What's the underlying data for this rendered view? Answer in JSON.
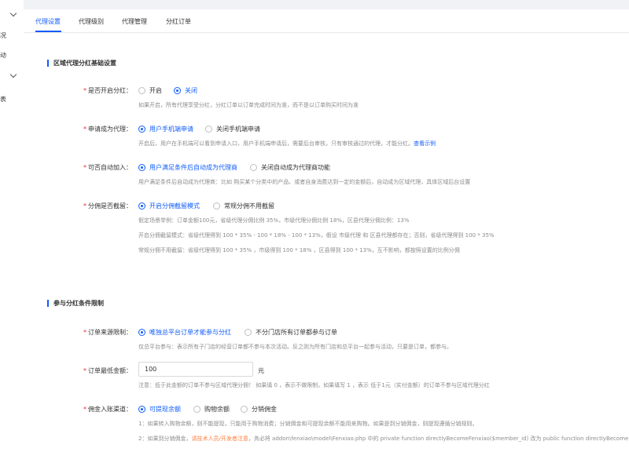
{
  "sidebar": {
    "items": [
      {
        "label": "况"
      },
      {
        "label": "动"
      },
      {
        "label": "表"
      }
    ]
  },
  "tabs": [
    {
      "label": "代理设置",
      "active": true
    },
    {
      "label": "代理级别"
    },
    {
      "label": "代理管理"
    },
    {
      "label": "分红订单"
    }
  ],
  "section1": {
    "title": "区域代理分红基础设置",
    "enable": {
      "label": "是否开启分红：",
      "options": [
        "开启",
        "关闭"
      ],
      "selected": "关闭",
      "hint": "如果开启，所有代理享受分红，分红订单以订单完成时间为准，而不是以订单购买时间为准"
    },
    "apply": {
      "label": "申请成为代理：",
      "options": [
        "用户手机端申请",
        "关闭手机端申请"
      ],
      "selected": "用户手机端申请",
      "hint": "开启后，用户在手机端可以看到申请入口，用户手机端申请后，需要后台审核，只有审核通过的代理，才能分红。",
      "hint_link": "查看示例"
    },
    "auto_join": {
      "label": "可否自动加入：",
      "options": [
        "用户满足条件后自动成为代理商",
        "关闭自动成为代理商功能"
      ],
      "selected": "用户满足条件后自动成为代理商",
      "hint": "用户满足条件后自动成为代理商：比如 购买某个分类中的产品、或者自身消费达到一定的金额后，自动成为区域代理，具体区域后台设置"
    },
    "retain": {
      "label": "分佣是否截留：",
      "options": [
        "开启分佣截留模式",
        "常规分佣不用截留"
      ],
      "selected": "开启分佣截留模式",
      "hints": [
        "假定场景举例：订单金额100元，省级代理分佣比例 35%，市级代理分佣比例 18%，区县代理分佣比例：13%",
        "开启分佣截留模式：省级代理得到 100 * 35% - 100 * 18% - 100 * 13%，假设 市级代理 和 区县代理都存在；否则，省级代理得到 100 * 35%",
        "常规分佣不用截留：省级代理得到 100 * 35% ，市级得到 100 * 18% ，区县得到 100 * 13%，互不影响，都按照设置的比例分佣"
      ]
    }
  },
  "section2": {
    "title": "参与分红条件限制",
    "source": {
      "label": "订单来源限制：",
      "options": [
        "唯独总平台订单才能参与分红",
        "不分门店所有订单都参与订单"
      ],
      "selected": "唯独总平台订单才能参与分红",
      "hint": "仅总平台参与：表示所有子门店的经营订单都不参与本次活动。反之则为所有门店和总平台一起参与活动，只要是订单，都参与。"
    },
    "min_amount": {
      "label": "订单最低金额：",
      "value": "100",
      "unit": "元",
      "hint": "注意：低于此金额的订单不参与区域代理分佣！ 如果填 0 ，表示不做限制，如果填写 1 ，表示 低于1元（实付金额）的订单不参与区域代理分红"
    },
    "channel": {
      "label": "佣金入账渠道：",
      "options": [
        "可提现余额",
        "购物余额",
        "分销佣金"
      ],
      "selected": "可提现余额",
      "hint1": "1：如果转入购物余额，则不能提现，只能用于购物消费；分销佣金和可提现余额不能用来购物。如果是到分销佣金，则提现遵循分销规则。",
      "hint2_prefix": "2：如果到分销佣金，",
      "hint2_warn": "请技术人员/开发者注意",
      "hint2_suffix": "，务必将 addon\\fenxiao\\model\\Fenxiao.php 中的 private function directlyBecomeFenxiao($member_id) 改为 public function directlyBecomeFe"
    }
  },
  "colors": {
    "primary": "#105cfb",
    "required": "#f5222d",
    "warn": "#ff8143",
    "hint": "#8c8c8c"
  }
}
